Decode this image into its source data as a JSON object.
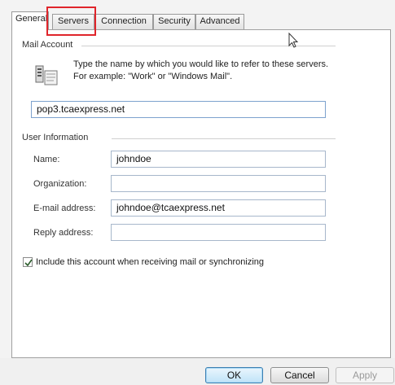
{
  "tabs": [
    {
      "label": "General"
    },
    {
      "label": "Servers"
    },
    {
      "label": "Connection"
    },
    {
      "label": "Security"
    },
    {
      "label": "Advanced"
    }
  ],
  "mail_account": {
    "heading": "Mail Account",
    "note": "Type the name by which you would like to refer to these servers.  For example: \"Work\" or \"Windows Mail\".",
    "account_name": "pop3.tcaexpress.net"
  },
  "user_info": {
    "heading": "User Information",
    "name_label": "Name:",
    "name_value": "johndoe",
    "org_label": "Organization:",
    "org_value": "",
    "email_label": "E-mail address:",
    "email_value": "johndoe@tcaexpress.net",
    "reply_label": "Reply address:",
    "reply_value": ""
  },
  "include_checkbox": {
    "label": "Include this account when receiving mail or synchronizing",
    "checked": true
  },
  "buttons": {
    "ok": "OK",
    "cancel": "Cancel",
    "apply": "Apply"
  },
  "colors": {
    "highlight": "#e0252b",
    "field_border": "#a7b7cb"
  }
}
